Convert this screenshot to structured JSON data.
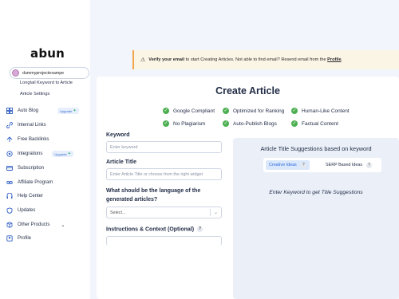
{
  "app": {
    "logo": "abun"
  },
  "site_selector": {
    "value": "dummyprojectexampe"
  },
  "sidebar": {
    "sub_items": [
      "Longtail Keyword to Article",
      "Article Settings"
    ],
    "items": [
      {
        "label": "Auto Blog",
        "badge": "Upgrade",
        "icon": "grid-icon"
      },
      {
        "label": "Internal Links",
        "icon": "link-icon"
      },
      {
        "label": "Free Backlinks",
        "icon": "backlink-icon"
      },
      {
        "label": "Integrations",
        "badge": "Upgrade",
        "icon": "puzzle-icon"
      },
      {
        "label": "Subscription",
        "icon": "card-icon"
      },
      {
        "label": "Affiliate Program",
        "icon": "affiliate-icon"
      },
      {
        "label": "Help Center",
        "icon": "help-icon"
      },
      {
        "label": "Updates",
        "icon": "updates-icon"
      },
      {
        "label": "Other Products",
        "icon": "products-icon"
      },
      {
        "label": "Profile",
        "icon": "profile-icon"
      }
    ]
  },
  "banner": {
    "bold": "Verify your email",
    "text": " to start Creating Articles. Not able to find email? Resend email from the ",
    "link": "Profile",
    "end": "."
  },
  "main": {
    "title": "Create Article",
    "features": [
      "Google Compliant",
      "Optimized for Ranking",
      "Human-Like Content",
      "No Plagiarism",
      "Auto-Publish Blogs",
      "Factual Content"
    ],
    "keyword": {
      "label": "Keyword",
      "placeholder": "Enter keyword"
    },
    "article_title": {
      "label": "Article Title",
      "placeholder": "Enter Article Title or choose from the right widget"
    },
    "language": {
      "label_line1": "What should be the language of the",
      "label_line2": "generated articles?",
      "selected": "Select..."
    },
    "instructions": {
      "label": "Instructions & Context (Optional)",
      "help": "?"
    }
  },
  "suggestions": {
    "title": "Article Title Suggestions based on keyword",
    "tabs": [
      {
        "label": "Creative Ideas",
        "help": "?"
      },
      {
        "label": "SERP Based Ideas",
        "help": "?"
      }
    ],
    "empty_text": "Enter Keyword to get Title Suggestions"
  },
  "colors": {
    "accent": "#2d6be0",
    "check": "#4caf50",
    "banner_bg": "#fbf5e6",
    "banner_border": "#f3a54b",
    "page_bg": "#f2f5fb"
  }
}
